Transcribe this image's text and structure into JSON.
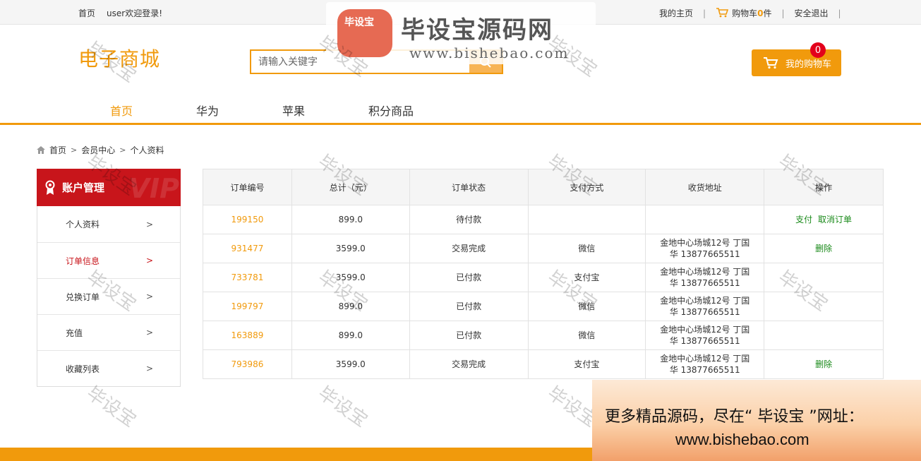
{
  "topbar": {
    "home": "首页",
    "welcome": "user欢迎登录!",
    "my_home": "我的主页",
    "cart_label": "购物车",
    "cart_count": "0",
    "cart_unit": "件",
    "logout": "安全退出"
  },
  "header": {
    "logo": "电子商城",
    "search_placeholder": "请输入关键字",
    "cart_button": "我的购物车",
    "cart_badge": "0"
  },
  "nav": {
    "items": [
      {
        "label": "首页",
        "active": true
      },
      {
        "label": "华为",
        "active": false
      },
      {
        "label": "苹果",
        "active": false
      },
      {
        "label": "积分商品",
        "active": false
      }
    ]
  },
  "breadcrumb": {
    "items": [
      "首页",
      "会员中心",
      "个人资料"
    ]
  },
  "sidebar": {
    "title": "账户管理",
    "vip_text": "VIP",
    "items": [
      {
        "label": "个人资料",
        "active": false
      },
      {
        "label": "订单信息",
        "active": true
      },
      {
        "label": "兑换订单",
        "active": false
      },
      {
        "label": "充值",
        "active": false
      },
      {
        "label": "收藏列表",
        "active": false
      }
    ]
  },
  "orders": {
    "headers": [
      "订单编号",
      "总计（元）",
      "订单状态",
      "支付方式",
      "收货地址",
      "操作"
    ],
    "rows": [
      {
        "id": "199150",
        "total": "899.0",
        "status": "待付款",
        "pay": "",
        "addr1": "",
        "addr2": "",
        "ops": [
          "支付",
          "取消订单"
        ]
      },
      {
        "id": "931477",
        "total": "3599.0",
        "status": "交易完成",
        "pay": "微信",
        "addr1": "金地中心场城12号  丁国",
        "addr2": "华  13877665511",
        "ops": [
          "删除"
        ]
      },
      {
        "id": "733781",
        "total": "3599.0",
        "status": "已付款",
        "pay": "支付宝",
        "addr1": "金地中心场城12号  丁国",
        "addr2": "华  13877665511",
        "ops": []
      },
      {
        "id": "199797",
        "total": "899.0",
        "status": "已付款",
        "pay": "微信",
        "addr1": "金地中心场城12号  丁国",
        "addr2": "华  13877665511",
        "ops": []
      },
      {
        "id": "163889",
        "total": "899.0",
        "status": "已付款",
        "pay": "微信",
        "addr1": "金地中心场城12号  丁国",
        "addr2": "华  13877665511",
        "ops": []
      },
      {
        "id": "793986",
        "total": "3599.0",
        "status": "交易完成",
        "pay": "支付宝",
        "addr1": "金地中心场城12号  丁国",
        "addr2": "华  13877665511",
        "ops": [
          "删除"
        ]
      }
    ]
  },
  "watermark": {
    "text": "毕设宝",
    "brand_title": "毕设宝源码网",
    "brand_url": "www.bishebao.com",
    "seal_text": "毕设宝"
  },
  "promo": {
    "line1": "更多精品源码，尽在“ 毕设宝 ”网址：",
    "line2": "www.bishebao.com"
  },
  "colors": {
    "accent": "#f19a0c",
    "sidebar_head": "#c8151b",
    "op_link": "#1a8a1a"
  }
}
